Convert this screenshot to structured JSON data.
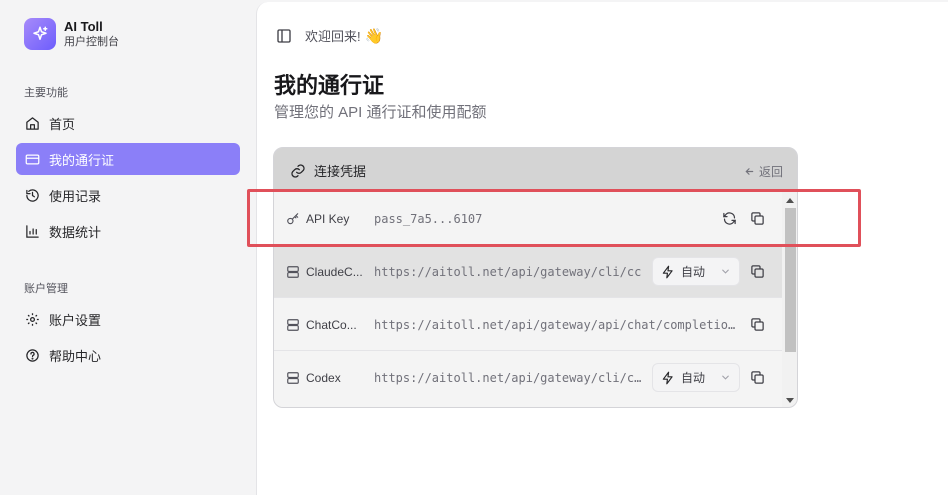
{
  "brand": {
    "name": "AI Toll",
    "subtitle": "用户控制台",
    "accent": "#8b7ff8"
  },
  "sidebar": {
    "section_main": "主要功能",
    "section_account": "账户管理",
    "main_items": [
      {
        "label": "首页",
        "icon": "home-icon",
        "active": false
      },
      {
        "label": "我的通行证",
        "icon": "card-icon",
        "active": true
      },
      {
        "label": "使用记录",
        "icon": "history-icon",
        "active": false
      },
      {
        "label": "数据统计",
        "icon": "bar-chart-icon",
        "active": false
      }
    ],
    "account_items": [
      {
        "label": "账户设置",
        "icon": "gear-icon",
        "active": false
      },
      {
        "label": "帮助中心",
        "icon": "help-icon",
        "active": false
      }
    ]
  },
  "header": {
    "welcome": "欢迎回来!",
    "wave": "👋"
  },
  "page": {
    "title": "我的通行证",
    "subtitle": "管理您的 API 通行证和使用配额"
  },
  "card": {
    "title": "连接凭据",
    "back_label": "返回",
    "rows": [
      {
        "name": "API Key",
        "value": "pass_7a5...6107",
        "icon": "key-icon",
        "actions": [
          "refresh-icon",
          "copy-icon"
        ]
      },
      {
        "name": "ClaudeC...",
        "value": "https://aitoll.net/api/gateway/cli/cc",
        "icon": "server-icon",
        "mode": "自动",
        "actions": [
          "copy-icon"
        ]
      },
      {
        "name": "ChatCo...",
        "value": "https://aitoll.net/api/gateway/api/chat/completio...",
        "icon": "server-icon",
        "actions": [
          "copy-icon"
        ]
      },
      {
        "name": "Codex",
        "value": "https://aitoll.net/api/gateway/cli/c...",
        "icon": "server-icon",
        "mode": "自动",
        "actions": [
          "copy-icon"
        ]
      }
    ]
  },
  "colors": {
    "highlight": "#e0505a",
    "active_nav": "#8b7ff8"
  }
}
